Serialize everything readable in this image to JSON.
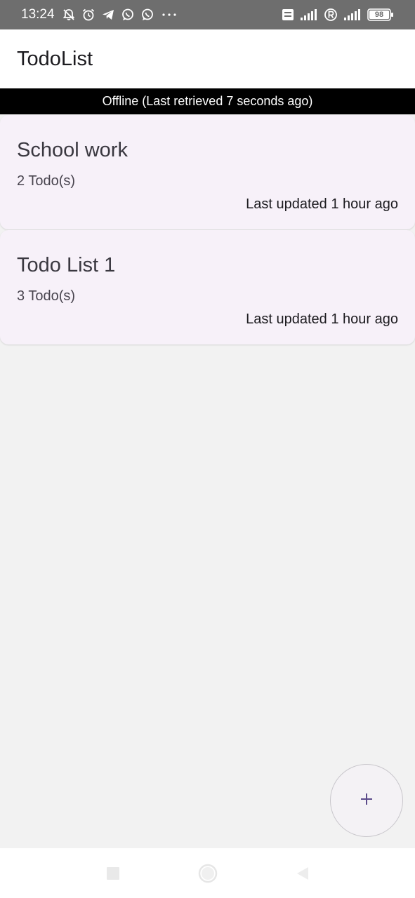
{
  "status_bar": {
    "time": "13:24",
    "battery": "98",
    "left_icons": [
      "bell-off-icon",
      "alarm-icon",
      "telegram-icon",
      "whatsapp-icon",
      "whatsapp-icon",
      "more-dots-icon"
    ],
    "right_icons": [
      "volte-icon",
      "signal-icon",
      "roaming-icon",
      "signal-icon",
      "battery-icon"
    ]
  },
  "app_bar": {
    "title": "TodoList"
  },
  "banner": {
    "text": "Offline (Last retrieved 7 seconds ago)"
  },
  "lists": [
    {
      "title": "School work",
      "count": "2 Todo(s)",
      "updated": "Last updated 1 hour ago"
    },
    {
      "title": "Todo List 1",
      "count": "3 Todo(s)",
      "updated": "Last updated 1 hour ago"
    }
  ],
  "fab": {
    "icon": "plus-icon",
    "color": "#5b4b8a"
  },
  "nav_bar": {
    "icons": [
      "recents-square-icon",
      "home-circle-icon",
      "back-triangle-icon"
    ]
  },
  "colors": {
    "card_bg": "#f7f1f9",
    "page_bg": "#f2f2f2",
    "status_bar_bg": "#6e6e6e",
    "banner_bg": "#000000"
  }
}
